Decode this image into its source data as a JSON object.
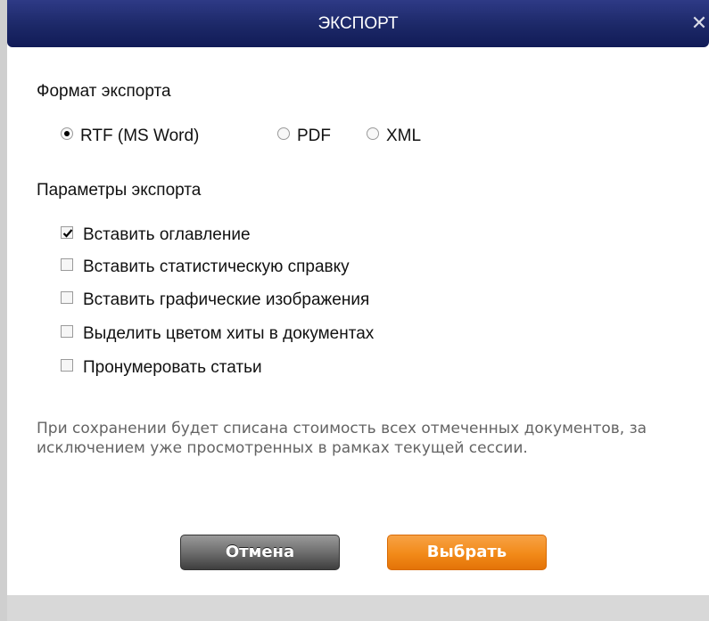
{
  "dialog": {
    "title": "ЭКСПОРТ",
    "close_symbol": "✕",
    "format_section": {
      "title": "Формат экспорта",
      "options": [
        {
          "label": "RTF (MS Word)",
          "checked": true
        },
        {
          "label": "PDF",
          "checked": false
        },
        {
          "label": "XML",
          "checked": false
        }
      ]
    },
    "params_section": {
      "title": "Параметры экспорта",
      "options": [
        {
          "label": "Вставить оглавление",
          "checked": true
        },
        {
          "label": "Вставить статистическую справку",
          "checked": false
        },
        {
          "label": "Вставить графические изображения",
          "checked": false
        },
        {
          "label": "Выделить цветом хиты в документах",
          "checked": false
        },
        {
          "label": "Пронумеровать статьи",
          "checked": false
        }
      ]
    },
    "note": "При сохранении будет списана стоимость всех отмеченных документов, за исключением уже просмотренных в рамках текущей сессии.",
    "buttons": {
      "cancel_label": "Отмена",
      "select_label": "Выбрать"
    }
  },
  "colors": {
    "titlebar": "#1c2867",
    "select_button": "#f28a19",
    "cancel_button": "#6e6e6e",
    "note_text": "#646464"
  },
  "icons": {
    "close": "close-icon",
    "checkmark": "checkmark-icon"
  }
}
